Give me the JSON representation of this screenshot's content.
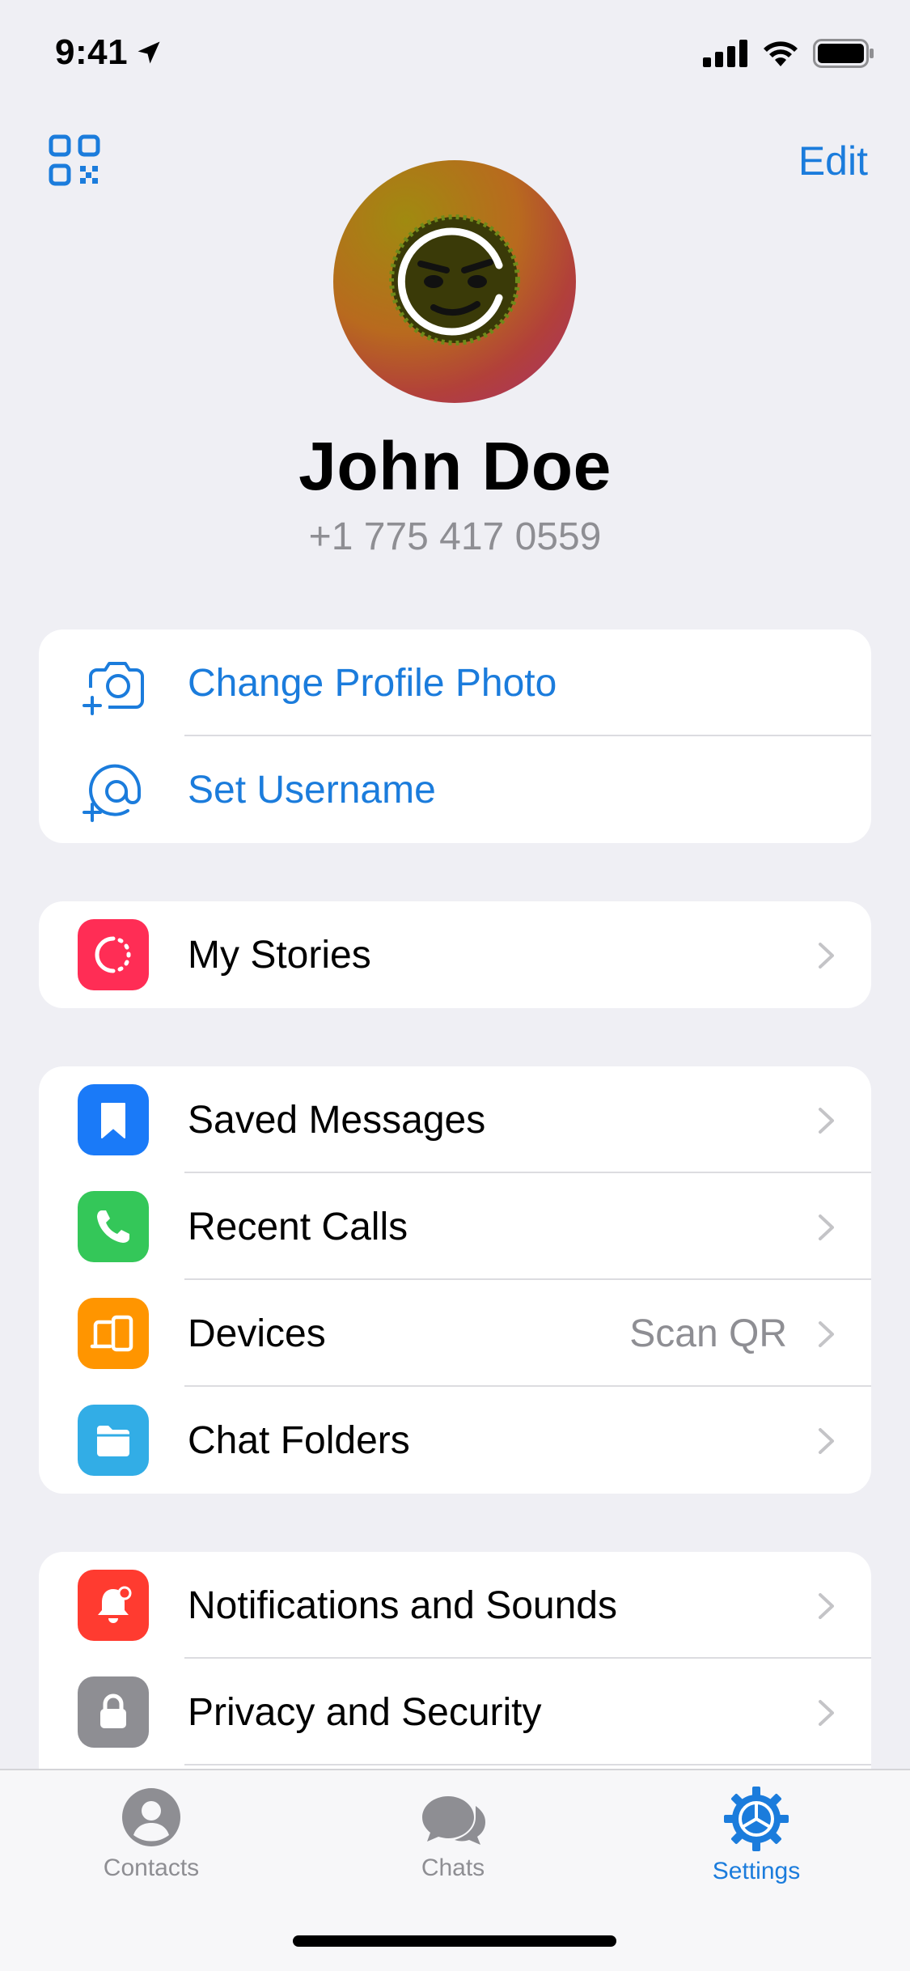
{
  "status_bar": {
    "time": "9:41"
  },
  "header": {
    "edit_label": "Edit"
  },
  "profile": {
    "name": "John Doe",
    "phone": "+1 775 417 0559"
  },
  "account_actions": [
    {
      "label": "Change Profile Photo",
      "icon": "camera-add-icon"
    },
    {
      "label": "Set Username",
      "icon": "at-add-icon"
    }
  ],
  "stories": [
    {
      "label": "My Stories",
      "icon": "stories-icon",
      "color": "#ff2d55"
    }
  ],
  "main_items": [
    {
      "label": "Saved Messages",
      "icon": "bookmark-icon",
      "color": "#1a7af8"
    },
    {
      "label": "Recent Calls",
      "icon": "phone-icon",
      "color": "#34c759"
    },
    {
      "label": "Devices",
      "icon": "devices-icon",
      "color": "#ff9500",
      "detail": "Scan QR"
    },
    {
      "label": "Chat Folders",
      "icon": "folder-icon",
      "color": "#32ade6"
    }
  ],
  "settings_items": [
    {
      "label": "Notifications and Sounds",
      "icon": "bell-icon",
      "color": "#ff3b30"
    },
    {
      "label": "Privacy and Security",
      "icon": "lock-icon",
      "color": "#8e8e93"
    }
  ],
  "tabbar": {
    "tabs": [
      {
        "label": "Contacts",
        "icon": "person-circle-icon"
      },
      {
        "label": "Chats",
        "icon": "chat-bubbles-icon"
      },
      {
        "label": "Settings",
        "icon": "gear-icon",
        "active": true
      }
    ]
  },
  "colors": {
    "accent": "#1b7cdc",
    "background": "#efeff4",
    "secondary_text": "#8e8e93"
  }
}
